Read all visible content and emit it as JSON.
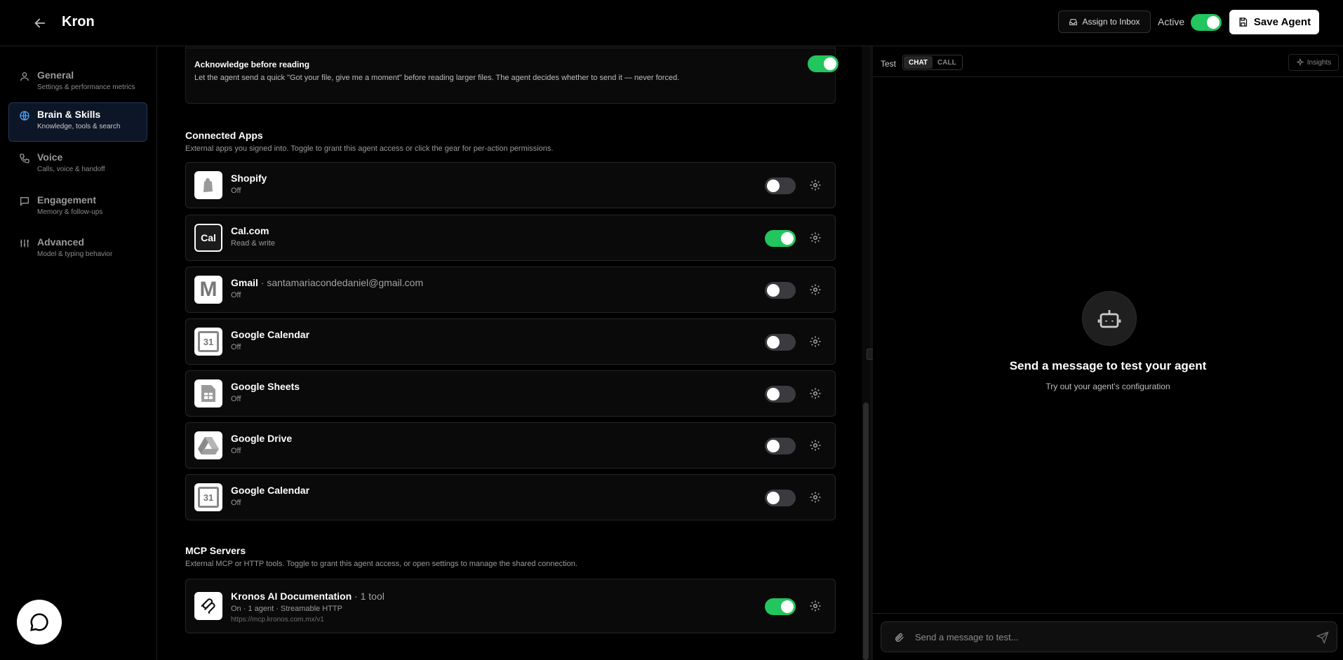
{
  "header": {
    "title": "Kron",
    "assign_label": "Assign to Inbox",
    "active_label": "Active",
    "active_on": true,
    "save_label": "Save Agent"
  },
  "sidebar": {
    "items": [
      {
        "title": "General",
        "subtitle": "Settings & performance metrics",
        "icon": "user-icon",
        "selected": false
      },
      {
        "title": "Brain & Skills",
        "subtitle": "Knowledge, tools & search",
        "icon": "globe-icon",
        "selected": true
      },
      {
        "title": "Voice",
        "subtitle": "Calls, voice & handoff",
        "icon": "phone-icon",
        "selected": false
      },
      {
        "title": "Engagement",
        "subtitle": "Memory & follow-ups",
        "icon": "message-square-icon",
        "selected": false
      },
      {
        "title": "Advanced",
        "subtitle": "Model & typing behavior",
        "icon": "sliders-icon",
        "selected": false
      }
    ]
  },
  "ack": {
    "title": "Acknowledge before reading",
    "description": "Let the agent send a quick \"Got your file, give me a moment\" before reading larger files. The agent decides whether to send it — never forced.",
    "on": true
  },
  "connected_apps": {
    "title": "Connected Apps",
    "description": "External apps you signed into. Toggle to grant this agent access or click the gear for per-action permissions.",
    "apps": [
      {
        "name": "Shopify",
        "email": "",
        "status": "Off",
        "on": false,
        "logo": "shopify-icon",
        "logo_text": ""
      },
      {
        "name": "Cal.com",
        "email": "",
        "status": "Read & write",
        "on": true,
        "logo": "calcom-icon",
        "logo_text": "Cal"
      },
      {
        "name": "Gmail",
        "email": " · santamariacondedaniel@gmail.com",
        "status": "Off",
        "on": false,
        "logo": "gmail-icon",
        "logo_text": "M"
      },
      {
        "name": "Google Calendar",
        "email": "",
        "status": "Off",
        "on": false,
        "logo": "google-calendar-icon",
        "logo_text": "31"
      },
      {
        "name": "Google Sheets",
        "email": "",
        "status": "Off",
        "on": false,
        "logo": "google-sheets-icon",
        "logo_text": ""
      },
      {
        "name": "Google Drive",
        "email": "",
        "status": "Off",
        "on": false,
        "logo": "google-drive-icon",
        "logo_text": ""
      },
      {
        "name": "Google Calendar",
        "email": "",
        "status": "Off",
        "on": false,
        "logo": "google-calendar-icon",
        "logo_text": "31"
      }
    ]
  },
  "mcp": {
    "title": "MCP Servers",
    "description": "External MCP or HTTP tools. Toggle to grant this agent access, or open settings to manage the shared connection.",
    "server": {
      "name": "Kronos AI Documentation",
      "tools": " · 1 tool",
      "status": "On · 1 agent · Streamable HTTP",
      "url": "https://mcp.kronos.com.mx/v1",
      "on": true
    }
  },
  "test_panel": {
    "label": "Test",
    "tabs": [
      "CHAT",
      "CALL"
    ],
    "insights_label": "Insights",
    "empty_title": "Send a message to test your agent",
    "empty_subtitle": "Try out your agent's configuration",
    "input_placeholder": "Send a message to test..."
  }
}
